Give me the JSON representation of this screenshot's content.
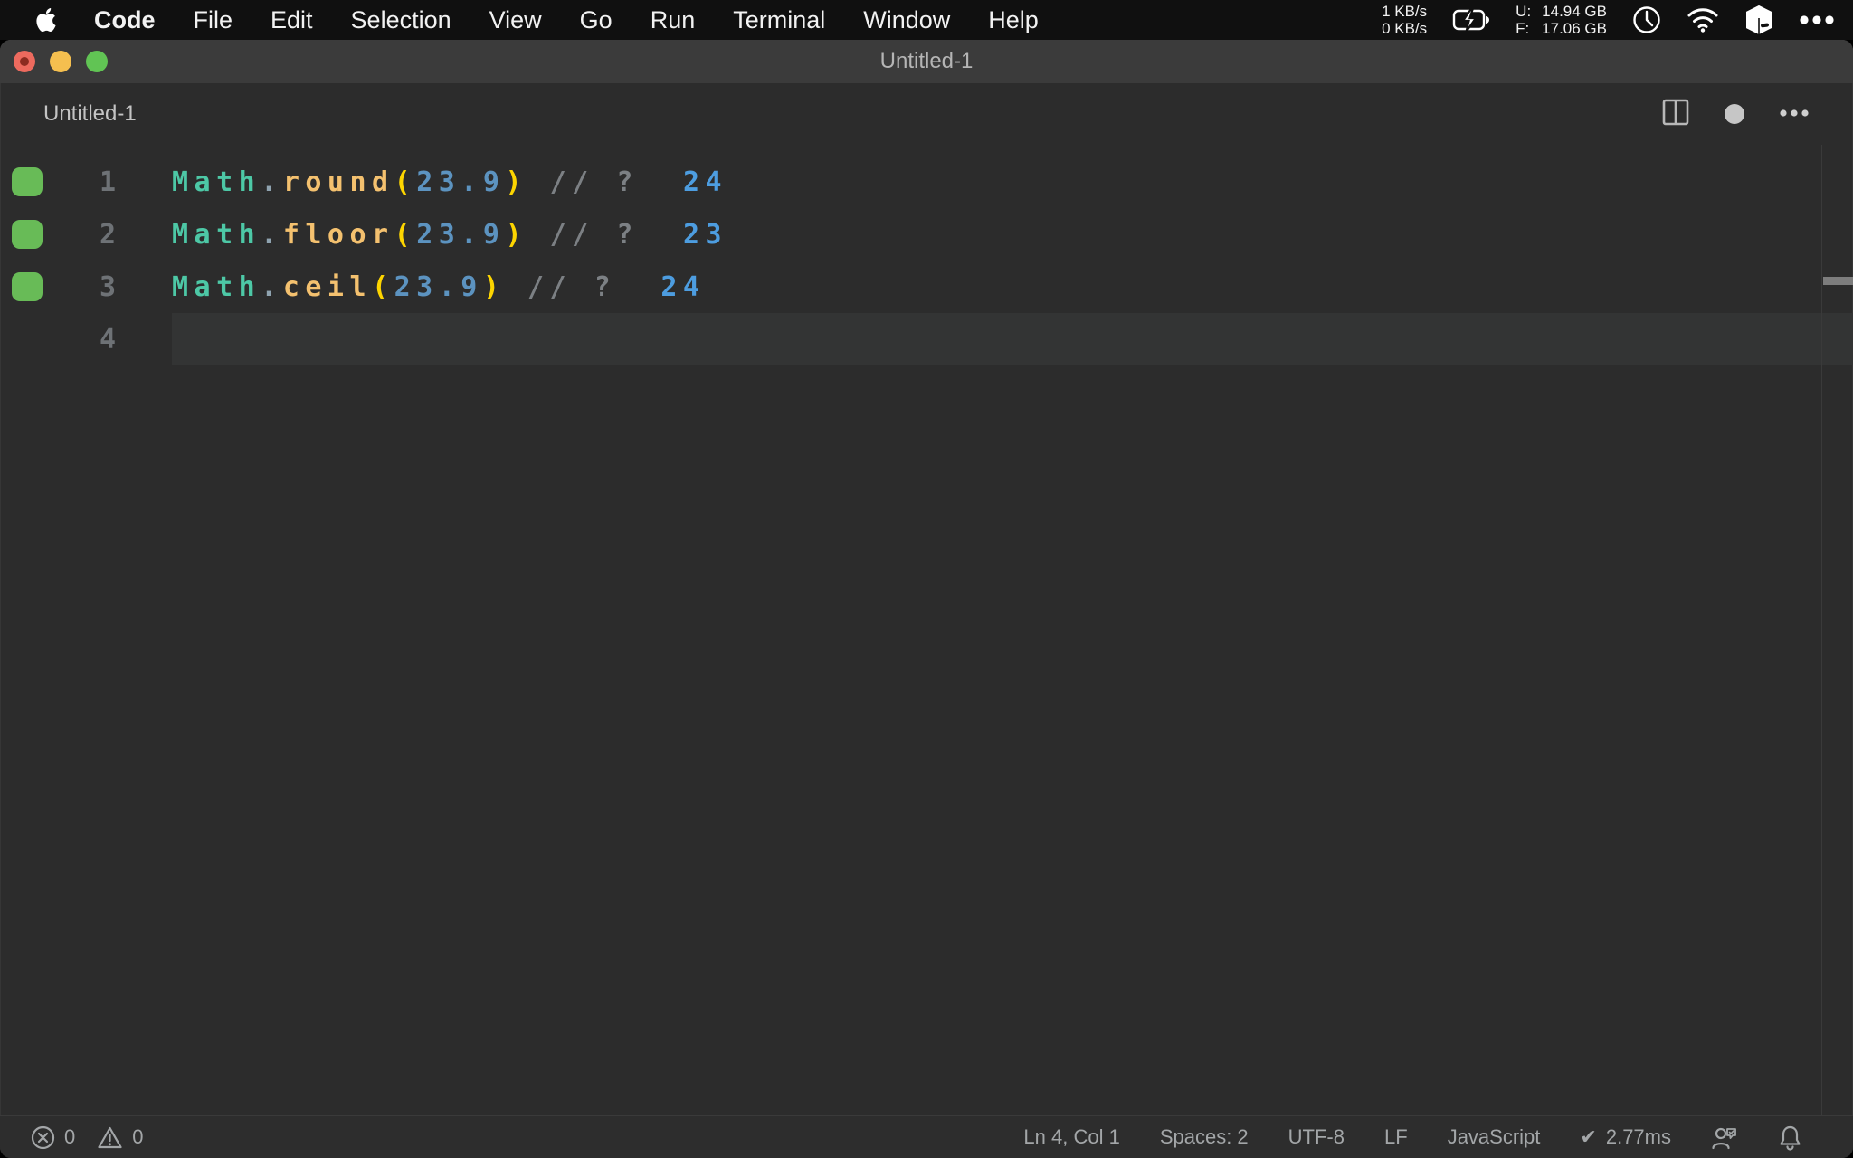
{
  "menubar": {
    "app": "Code",
    "items": [
      "File",
      "Edit",
      "Selection",
      "View",
      "Go",
      "Run",
      "Terminal",
      "Window",
      "Help"
    ],
    "status": {
      "net_up": "1 KB/s",
      "net_down": "0 KB/s",
      "mem_used_label": "U:",
      "mem_used": "14.94 GB",
      "mem_free_label": "F:",
      "mem_free": "17.06 GB"
    }
  },
  "window": {
    "title": "Untitled-1",
    "tab": {
      "label": "Untitled-1"
    }
  },
  "editor": {
    "language_hint": "JavaScript",
    "lines": [
      {
        "number": "1",
        "covered": true,
        "current": false,
        "tokens": [
          {
            "t": "Math",
            "c": "object"
          },
          {
            "t": ".",
            "c": "punct"
          },
          {
            "t": "round",
            "c": "method"
          },
          {
            "t": "(",
            "c": "bracket"
          },
          {
            "t": "23.9",
            "c": "number"
          },
          {
            "t": ")",
            "c": "bracket"
          },
          {
            "t": " ",
            "c": "plain"
          },
          {
            "t": "// ?",
            "c": "comment"
          },
          {
            "t": "  ",
            "c": "plain"
          },
          {
            "t": "24",
            "c": "result"
          }
        ]
      },
      {
        "number": "2",
        "covered": true,
        "current": false,
        "tokens": [
          {
            "t": "Math",
            "c": "object"
          },
          {
            "t": ".",
            "c": "punct"
          },
          {
            "t": "floor",
            "c": "method"
          },
          {
            "t": "(",
            "c": "bracket"
          },
          {
            "t": "23.9",
            "c": "number"
          },
          {
            "t": ")",
            "c": "bracket"
          },
          {
            "t": " ",
            "c": "plain"
          },
          {
            "t": "// ?",
            "c": "comment"
          },
          {
            "t": "  ",
            "c": "plain"
          },
          {
            "t": "23",
            "c": "result"
          }
        ]
      },
      {
        "number": "3",
        "covered": true,
        "current": false,
        "tokens": [
          {
            "t": "Math",
            "c": "object"
          },
          {
            "t": ".",
            "c": "punct"
          },
          {
            "t": "ceil",
            "c": "method"
          },
          {
            "t": "(",
            "c": "bracket"
          },
          {
            "t": "23.9",
            "c": "number"
          },
          {
            "t": ")",
            "c": "bracket"
          },
          {
            "t": " ",
            "c": "plain"
          },
          {
            "t": "// ?",
            "c": "comment"
          },
          {
            "t": "  ",
            "c": "plain"
          },
          {
            "t": "24",
            "c": "result"
          }
        ]
      },
      {
        "number": "4",
        "covered": false,
        "current": true,
        "tokens": []
      }
    ]
  },
  "statusbar": {
    "errors": "0",
    "warnings": "0",
    "cursor": "Ln 4, Col 1",
    "indent": "Spaces: 2",
    "encoding": "UTF-8",
    "eol": "LF",
    "language": "JavaScript",
    "perf_check": "✔",
    "perf": "2.77ms"
  },
  "colors": {
    "traffic_red": "#ed6a5e",
    "traffic_red_dot": "#8c2b20",
    "traffic_yellow": "#f5bf4f",
    "traffic_green": "#61c454",
    "coverage_green": "#68bb57",
    "tokens": {
      "object": "#4dc8a6",
      "punct": "#8fa3b0",
      "method": "#f4c16f",
      "bracket": "#fdd500",
      "number": "#5c93c0",
      "comment": "#7c8084",
      "result": "#4d9de0",
      "plain": "#d4d4d4"
    }
  }
}
